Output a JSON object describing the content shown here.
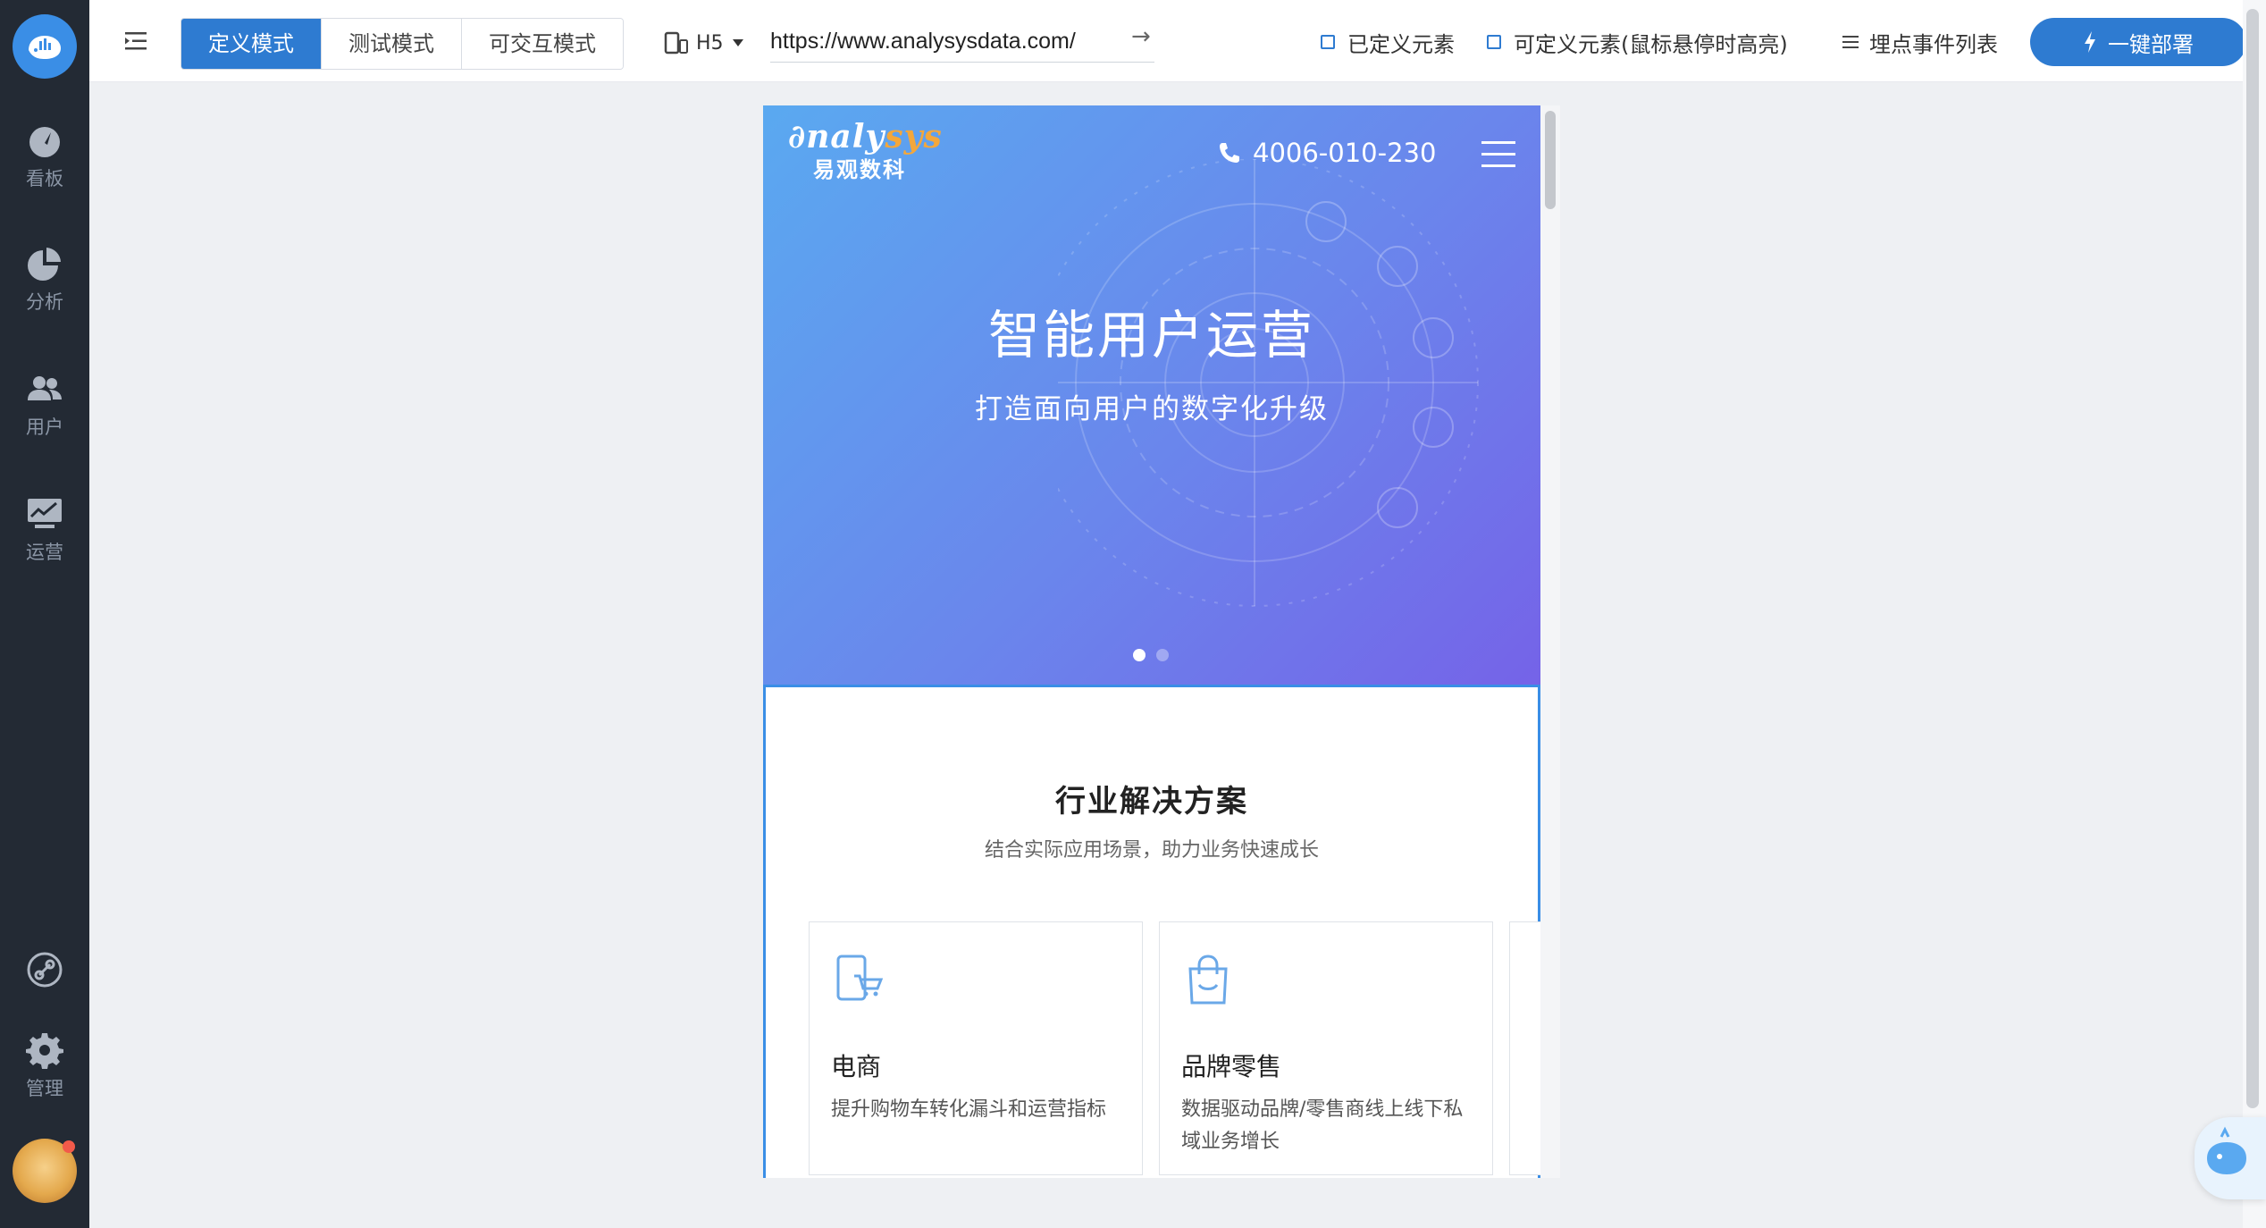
{
  "sidebar": {
    "items": [
      {
        "label": "看板",
        "icon": "dashboard-icon"
      },
      {
        "label": "分析",
        "icon": "pie-chart-icon"
      },
      {
        "label": "用户",
        "icon": "users-icon"
      },
      {
        "label": "运营",
        "icon": "monitor-chart-icon"
      }
    ],
    "bottom": [
      {
        "label": "",
        "icon": "link-icon"
      },
      {
        "label": "管理",
        "icon": "gear-icon"
      }
    ]
  },
  "toolbar": {
    "modes": [
      "定义模式",
      "测试模式",
      "可交互模式"
    ],
    "active_mode": "定义模式",
    "device": "H5",
    "url": "https://www.analysysdata.com/",
    "defined_elements": "已定义元素",
    "definable_elements": "可定义元素(鼠标悬停时高亮)",
    "event_list": "埋点事件列表",
    "deploy": "一键部署"
  },
  "preview": {
    "brand_en_a": "nalysys",
    "brand_en_prefix": "∂",
    "brand_cn": "易观数科",
    "phone": "4006-010-230",
    "hero_title": "智能用户运营",
    "hero_subtitle": "打造面向用户的数字化升级",
    "solution_title": "行业解决方案",
    "solution_subtitle": "结合实际应用场景，助力业务快速成长",
    "cards": [
      {
        "title": "电商",
        "desc": "提升购物车转化漏斗和运营指标",
        "icon": "ecommerce-icon"
      },
      {
        "title": "品牌零售",
        "desc": "数据驱动品牌/零售商线上线下私域业务增长",
        "icon": "shopping-bag-icon"
      }
    ]
  },
  "colors": {
    "accent": "#2e7bd1",
    "sidebar": "#232a34",
    "hero_start": "#5aa9f0",
    "hero_end": "#7563e8",
    "brand_orange": "#f3a73b"
  }
}
